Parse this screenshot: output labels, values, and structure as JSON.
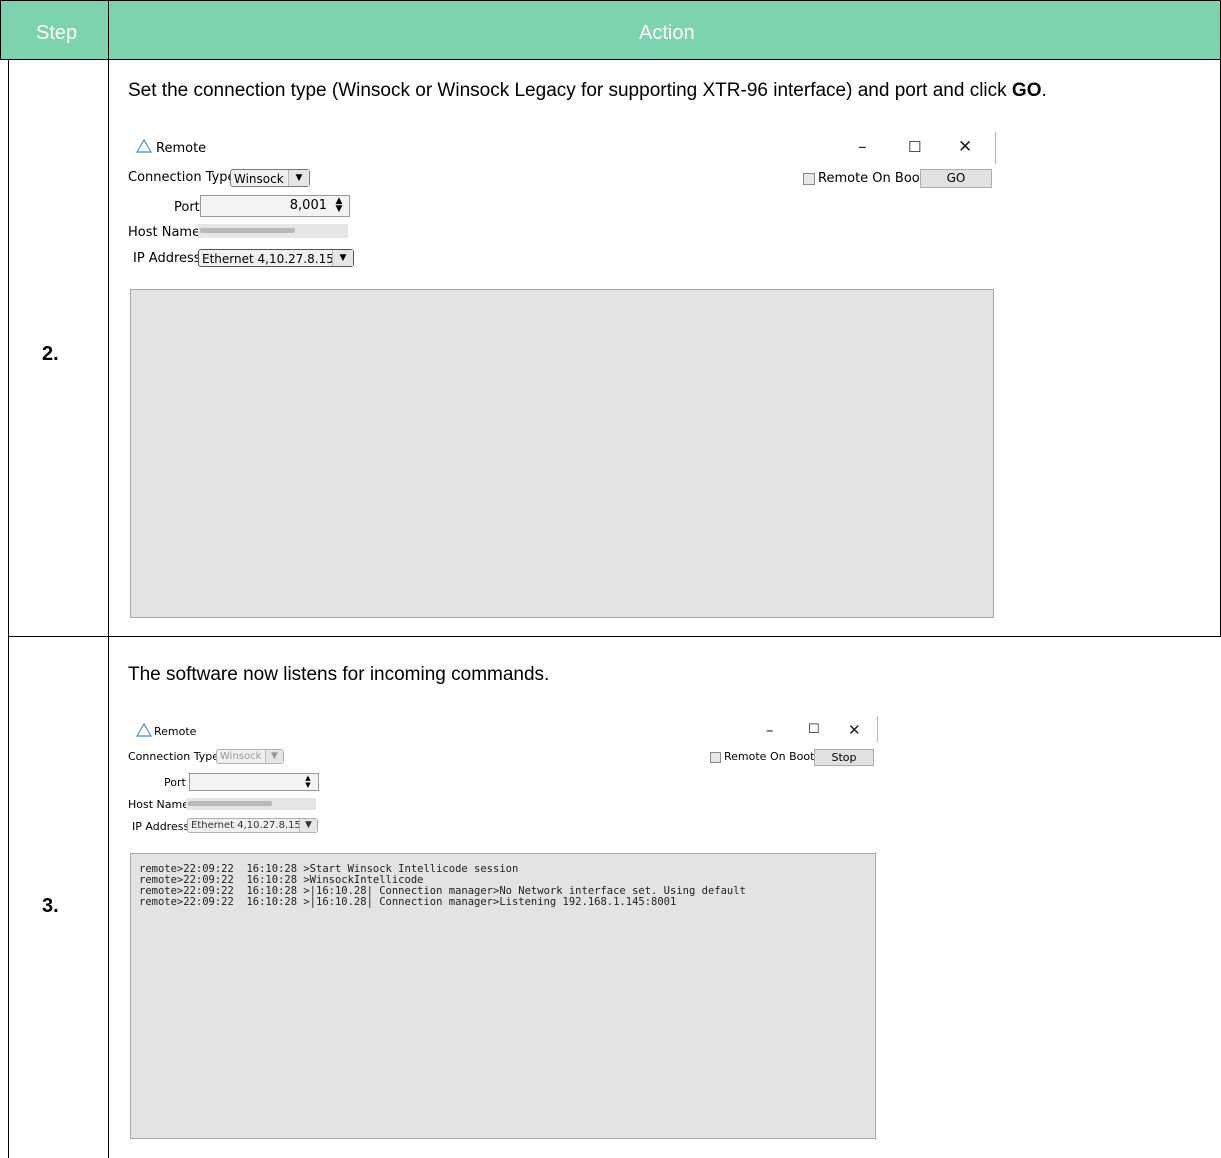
{
  "table": {
    "header_step": "Step",
    "header_action": "Action"
  },
  "rows": [
    {
      "step": "2.",
      "instruction_pre": "Set the connection type (Winsock or Winsock Legacy for supporting XTR-96 interface) and port and click ",
      "instruction_bold": "GO",
      "instruction_post": ".",
      "dialog": {
        "title": "Remote",
        "connection_type_label": "Connection Type",
        "connection_type_value": "Winsock",
        "port_label": "Port",
        "port_value": "8,001",
        "host_label": "Host Name",
        "ip_label": "IP Address",
        "ip_value": "Ethernet 4,10.27.8.15)",
        "remote_on_boot_label": "Remote On Boot",
        "action_button": "GO",
        "log_lines": []
      }
    },
    {
      "step": "3.",
      "instruction": "The software now listens for incoming commands.",
      "dialog": {
        "title": "Remote",
        "connection_type_label": "Connection Type",
        "connection_type_value": "Winsock",
        "port_label": "Port",
        "port_value": "",
        "host_label": "Host Name",
        "ip_label": "IP Address",
        "ip_value": "Ethernet 4,10.27.8.15)",
        "remote_on_boot_label": "Remote On Boot",
        "action_button": "Stop",
        "log_lines": [
          "remote>22:09:22  16:10:28 >Start Winsock Intellicode session",
          "remote>22:09:22  16:10:28 >WinsockIntellicode",
          "remote>22:09:22  16:10:28 >|16:10.28| Connection manager>No Network interface set. Using default",
          "remote>22:09:22  16:10:28 >|16:10.28| Connection manager>Listening 192.168.1.145:8001"
        ]
      }
    }
  ],
  "icons": {
    "window_minimize": "minimize-icon",
    "window_maximize": "maximize-icon",
    "window_close": "close-icon",
    "app_logo": "triangle-logo-icon"
  },
  "colors": {
    "header_bg": "#7dd3ad",
    "header_text": "#ffffff"
  }
}
